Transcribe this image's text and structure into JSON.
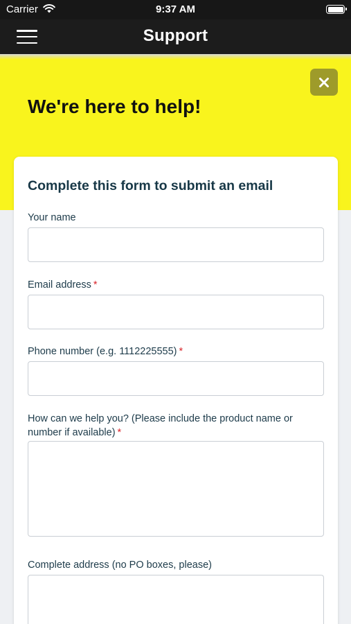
{
  "status_bar": {
    "carrier": "Carrier",
    "time": "9:37 AM",
    "wifi_icon": "wifi-icon",
    "battery_icon": "battery-icon"
  },
  "nav": {
    "title": "Support",
    "menu_icon": "hamburger-menu-icon"
  },
  "hero": {
    "title": "We're here to help!",
    "close_icon": "close-icon",
    "background_color": "#f9f41d"
  },
  "form": {
    "title": "Complete this form to submit an email",
    "required_marker": "*",
    "fields": [
      {
        "label": "Your name",
        "required": false,
        "value": ""
      },
      {
        "label": "Email address",
        "required": true,
        "value": ""
      },
      {
        "label": "Phone number (e.g. 1112225555)",
        "required": true,
        "value": ""
      },
      {
        "label": "How can we help you? (Please include the product name or number if available)",
        "required": true,
        "value": ""
      },
      {
        "label": "Complete address (no PO boxes, please)",
        "required": false,
        "value": ""
      }
    ]
  },
  "colors": {
    "nav_background": "#1c1c1c",
    "accent_yellow": "#f9f41d",
    "close_button": "#9e9b2a",
    "required_marker": "#d9262c",
    "text_primary": "#1d3b4a"
  }
}
